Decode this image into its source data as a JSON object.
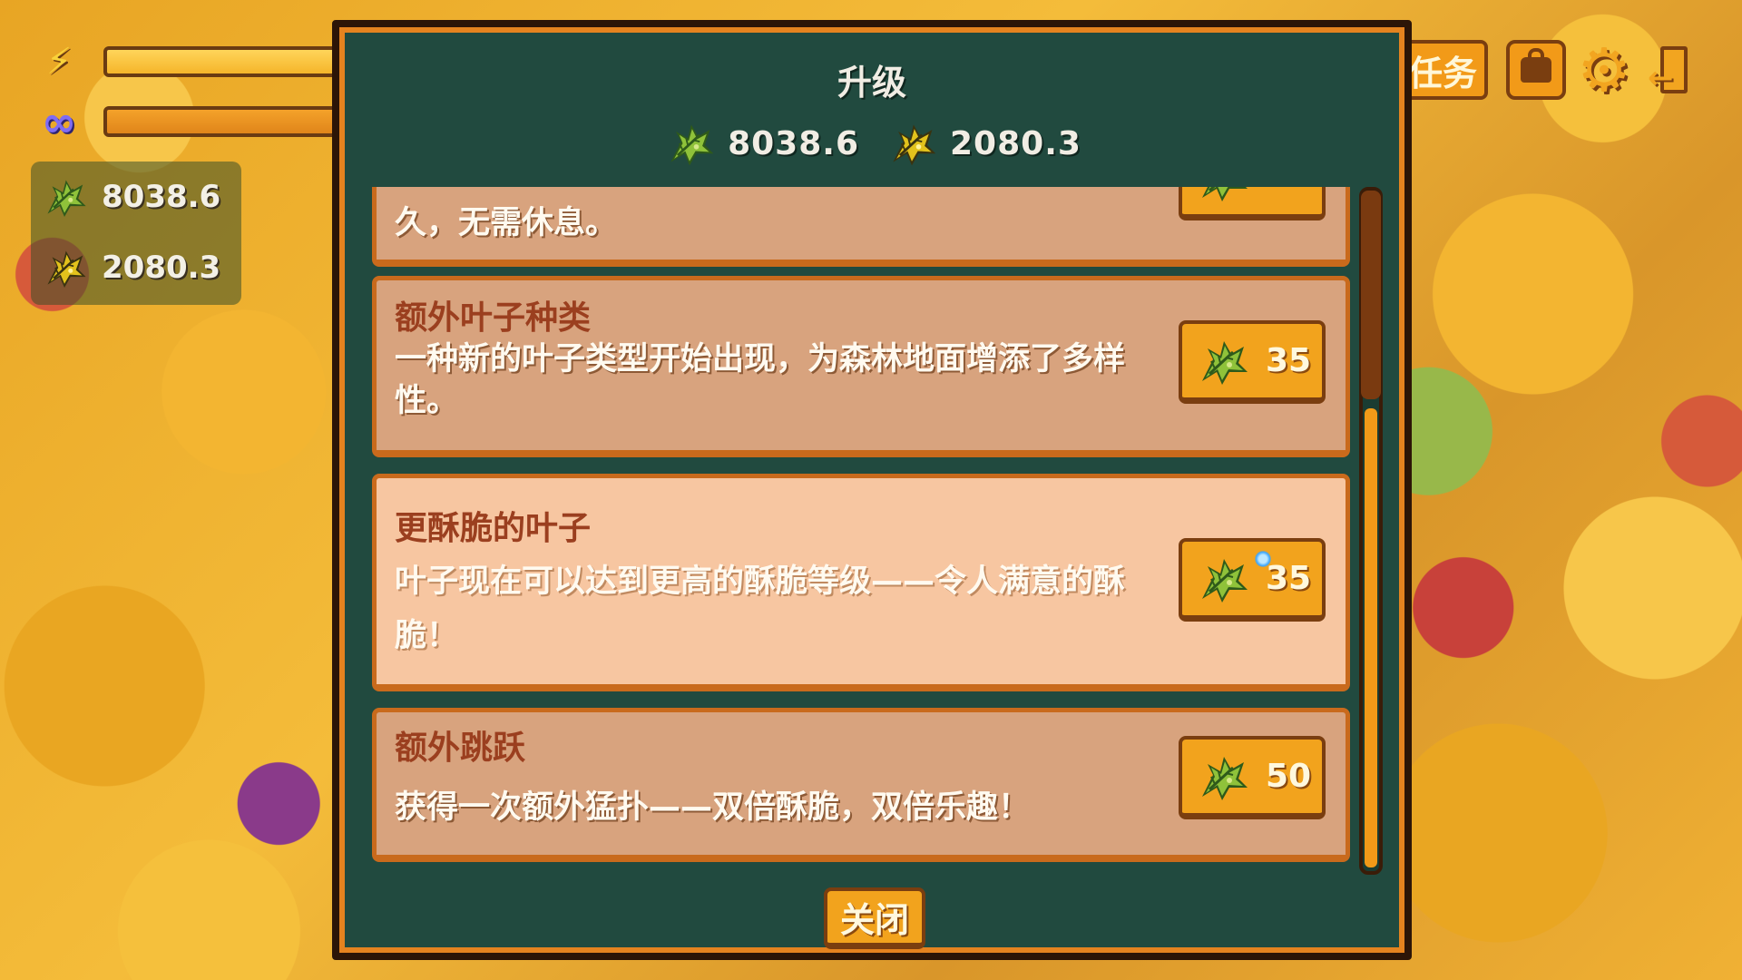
{
  "hud": {
    "energy_icon": "lightning-icon",
    "infinity_icon": "infinity-icon",
    "leaf_green_amount": "8038.6",
    "leaf_gold_amount": "2080.3"
  },
  "top_right": {
    "quest_label": "任务",
    "inventory_icon": "bag-icon",
    "settings_icon": "gear-icon",
    "exit_icon": "exit-door-icon"
  },
  "modal": {
    "title": "升级",
    "currency": {
      "green_leaf": "8038.6",
      "gold_leaf": "2080.3"
    },
    "upgrades": [
      {
        "title": "",
        "desc": "久，无需休息。",
        "price": ""
      },
      {
        "title": "额外叶子种类",
        "desc": "一种新的叶子类型开始出现，为森林地面增添了多样性。",
        "price": "35"
      },
      {
        "title": "更酥脆的叶子",
        "desc": "叶子现在可以达到更高的酥脆等级——令人满意的酥脆！",
        "price": "35"
      },
      {
        "title": "额外跳跃",
        "desc": "获得一次额外猛扑——双倍酥脆，双倍乐趣！",
        "price": "50"
      }
    ],
    "close_label": "关闭"
  },
  "colors": {
    "panel_bg": "#214a3f",
    "panel_border": "#e5831f",
    "card_bg": "#d8a37e",
    "card_hover_bg": "#f7c6a1",
    "button_bg": "#f2a31d",
    "title_text": "#9b3f1f"
  }
}
